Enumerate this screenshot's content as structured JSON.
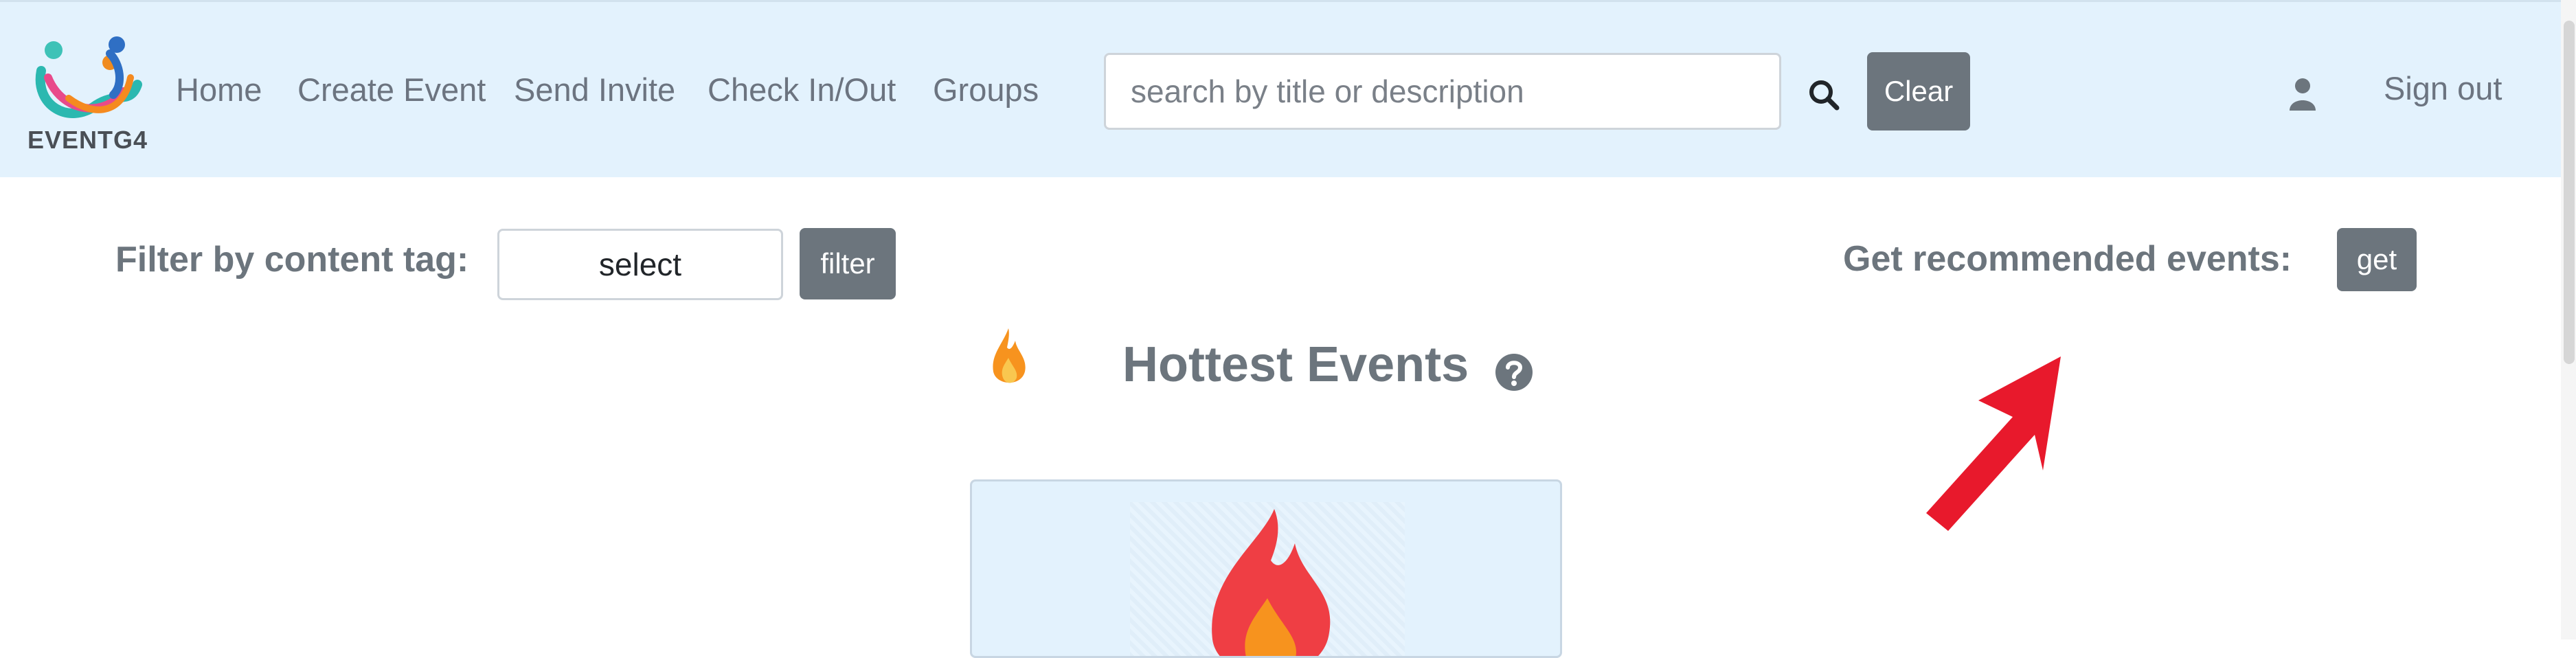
{
  "brand": {
    "name": "EVENTG4"
  },
  "nav": {
    "links": [
      "Home",
      "Create Event",
      "Send Invite",
      "Check In/Out",
      "Groups"
    ],
    "sign_out": "Sign out"
  },
  "search": {
    "placeholder": "search by title or description",
    "value": "",
    "clear_label": "Clear"
  },
  "filter": {
    "label": "Filter by content tag:",
    "select_value": "select",
    "button_label": "filter"
  },
  "recommend": {
    "label": "Get recommended events:",
    "button_label": "get"
  },
  "hottest": {
    "title": "Hottest Events"
  },
  "icons": {
    "search": "search-icon",
    "user": "user-icon",
    "help": "question-circle-icon",
    "flame": "flame-icon",
    "arrow": "red-arrow-annotation"
  },
  "colors": {
    "navbar_bg": "#e3f2fd",
    "button_bg": "#6c757d",
    "text_muted": "#6c757d",
    "arrow": "#e8192c",
    "flame_red": "#ef3e44",
    "flame_orange": "#f7931e"
  }
}
